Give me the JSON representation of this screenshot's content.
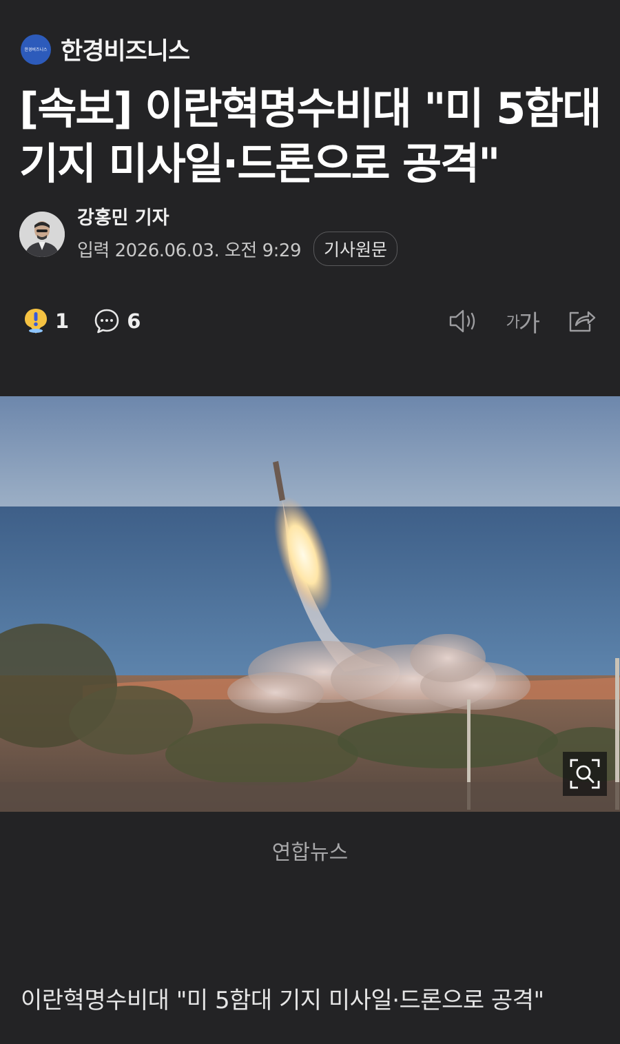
{
  "publisher": {
    "logo_text": "한경비즈니스",
    "name": "한경비즈니스"
  },
  "article": {
    "headline": "[속보] 이란혁명수비대 \"미 5함대 기지 미사일·드론으로 공격\"",
    "reporter_name": "강홍민 기자",
    "input_date": "입력 2026.06.03. 오전 9:29",
    "original_button": "기사원문",
    "photo_credit": "연합뉴스",
    "caption": "이란혁명수비대 \"미 5함대 기지 미사일·드론으로 공격\""
  },
  "actions": {
    "reaction_count": "1",
    "comment_count": "6",
    "font_size_small": "가",
    "font_size_large": "가"
  },
  "colors": {
    "background": "#232325",
    "publisher_logo": "#2d5bbb",
    "reaction_icon": "#f5c242"
  },
  "icons": [
    "exclamation-reaction-icon",
    "comment-icon",
    "speaker-icon",
    "font-size-icon",
    "share-icon",
    "zoom-search-icon"
  ]
}
